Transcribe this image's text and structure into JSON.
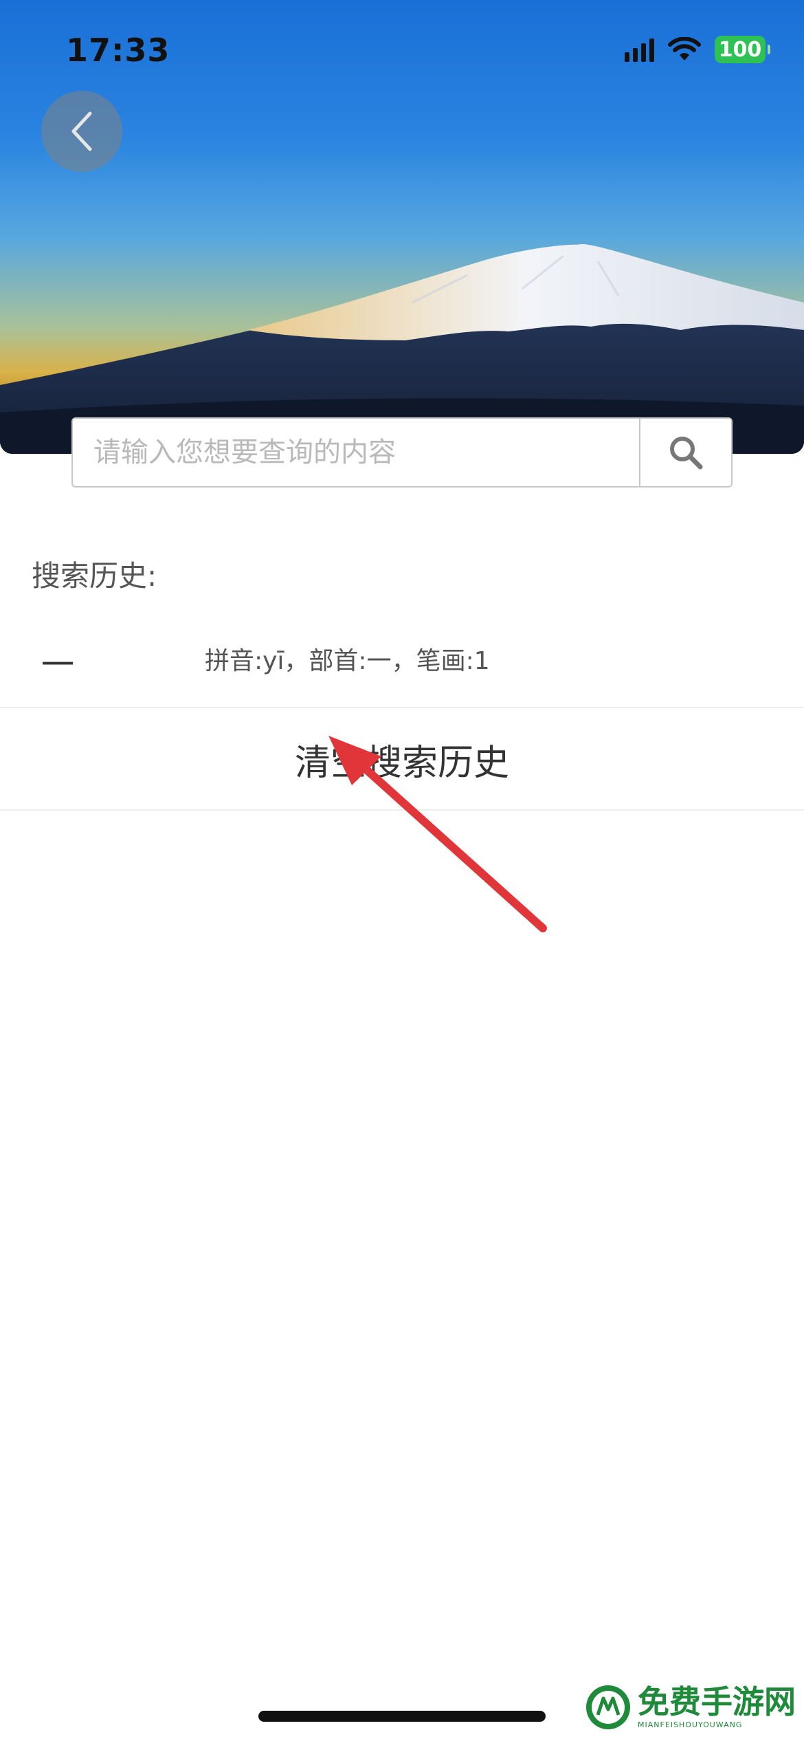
{
  "status_bar": {
    "time": "17:33",
    "battery": "100"
  },
  "search": {
    "placeholder": "请输入您想要查询的内容",
    "value": ""
  },
  "history": {
    "heading": "搜索历史:",
    "items": [
      {
        "char": "一",
        "detail": "拼音:yī，部首:一，笔画:1"
      }
    ],
    "clear_label": "清空搜索历史"
  },
  "watermark": {
    "main": "免费手游网",
    "sub": "MIANFEISHOUYOUWANG"
  },
  "colors": {
    "annotation_arrow": "#e0363a",
    "battery": "#2ec254",
    "watermark": "#1e8a3a"
  },
  "icons": [
    "back-chevron-icon",
    "search-icon",
    "signal-icon",
    "wifi-icon",
    "battery-icon",
    "watermark-logo-icon"
  ]
}
